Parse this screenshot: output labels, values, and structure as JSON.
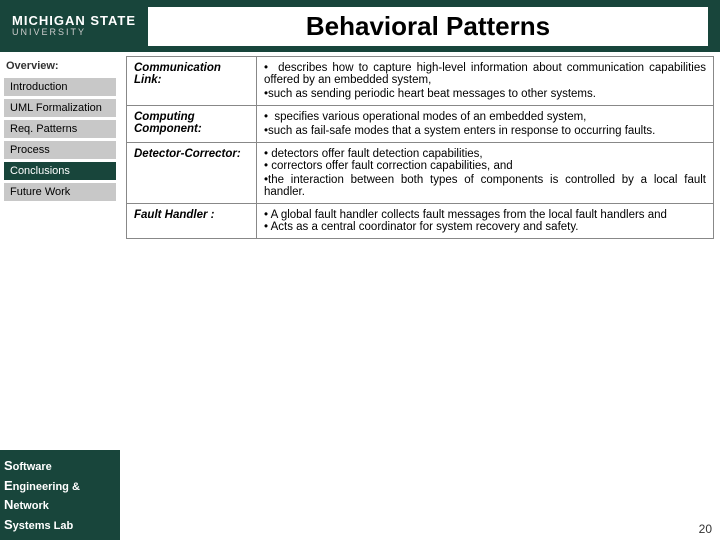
{
  "header": {
    "msu_name": "MICHIGAN STATE",
    "msu_sub": "UNIVERSITY",
    "title": "Behavioral Patterns"
  },
  "sidebar": {
    "overview_label": "Overview:",
    "items": [
      {
        "label": "Introduction",
        "active": false
      },
      {
        "label": "UML Formalization",
        "active": false
      },
      {
        "label": "Req. Patterns",
        "active": false
      },
      {
        "label": "Process",
        "active": false
      },
      {
        "label": "Conclusions",
        "active": true
      },
      {
        "label": "Future Work",
        "active": false
      }
    ]
  },
  "table": {
    "rows": [
      {
        "term": "Communication Link:",
        "description": "•  describes how to capture high-level information about communication capabilities offered by an embedded system,\n•such as sending periodic heart beat messages to other systems."
      },
      {
        "term": "Computing Component:",
        "description": "•  specifies various operational modes of an embedded system,\n•such as fail-safe modes that a system enters in response to occurring faults."
      },
      {
        "term": "Detector-Corrector:",
        "description": "• detectors offer fault detection capabilities,\n• correctors offer fault correction capabilities, and\n•the interaction between both types of components is controlled by a local fault handler."
      },
      {
        "term": "Fault Handler :",
        "description": "• A global fault handler collects fault messages from the local fault handlers and\n• Acts as a central coordinator for system recovery and safety."
      }
    ]
  },
  "footer": {
    "lines": [
      "Software",
      "Engineering &",
      "Network",
      "Systems Lab"
    ]
  },
  "page_number": "20"
}
